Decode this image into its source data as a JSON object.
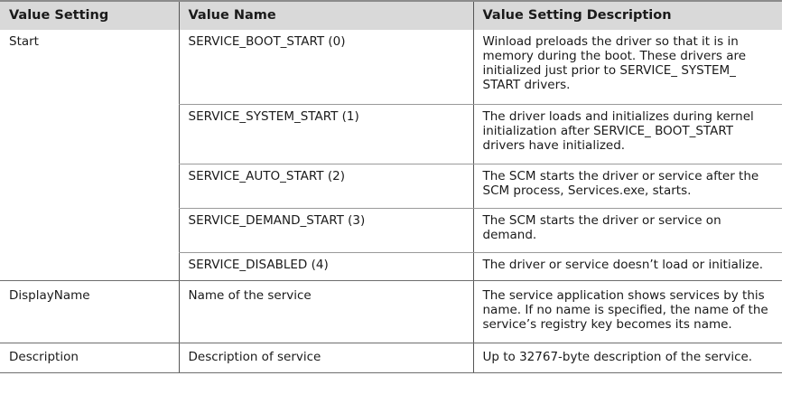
{
  "table": {
    "headers": [
      "Value Setting",
      "Value Name",
      "Value Setting Description"
    ],
    "rows": [
      {
        "setting": "Start",
        "name": "SERVICE_BOOT_START (0)",
        "description": "Winload preloads the driver so that it is in memory during the boot. These drivers are initialized just prior to SERVICE_ SYSTEM_ START drivers."
      },
      {
        "setting": "",
        "name": "SERVICE_SYSTEM_START (1)",
        "description": "The driver loads and initializes during kernel initialization after SERVICE_ BOOT_START drivers have initialized."
      },
      {
        "setting": "",
        "name": "SERVICE_AUTO_START (2)",
        "description": "The SCM starts the driver or service after the SCM process, Services.exe, starts."
      },
      {
        "setting": "",
        "name": "SERVICE_DEMAND_START (3)",
        "description": "The SCM starts the driver or service on demand."
      },
      {
        "setting": "",
        "name": "SERVICE_DISABLED (4)",
        "description": "The driver or service doesn’t load or initialize."
      },
      {
        "setting": "DisplayName",
        "name": "Name of the service",
        "description": "The service application shows services by this name. If no name is specified, the name of the service’s registry key becomes its name."
      },
      {
        "setting": "Description",
        "name": "Description of service",
        "description": "Up to 32767-byte description of the service."
      }
    ]
  }
}
